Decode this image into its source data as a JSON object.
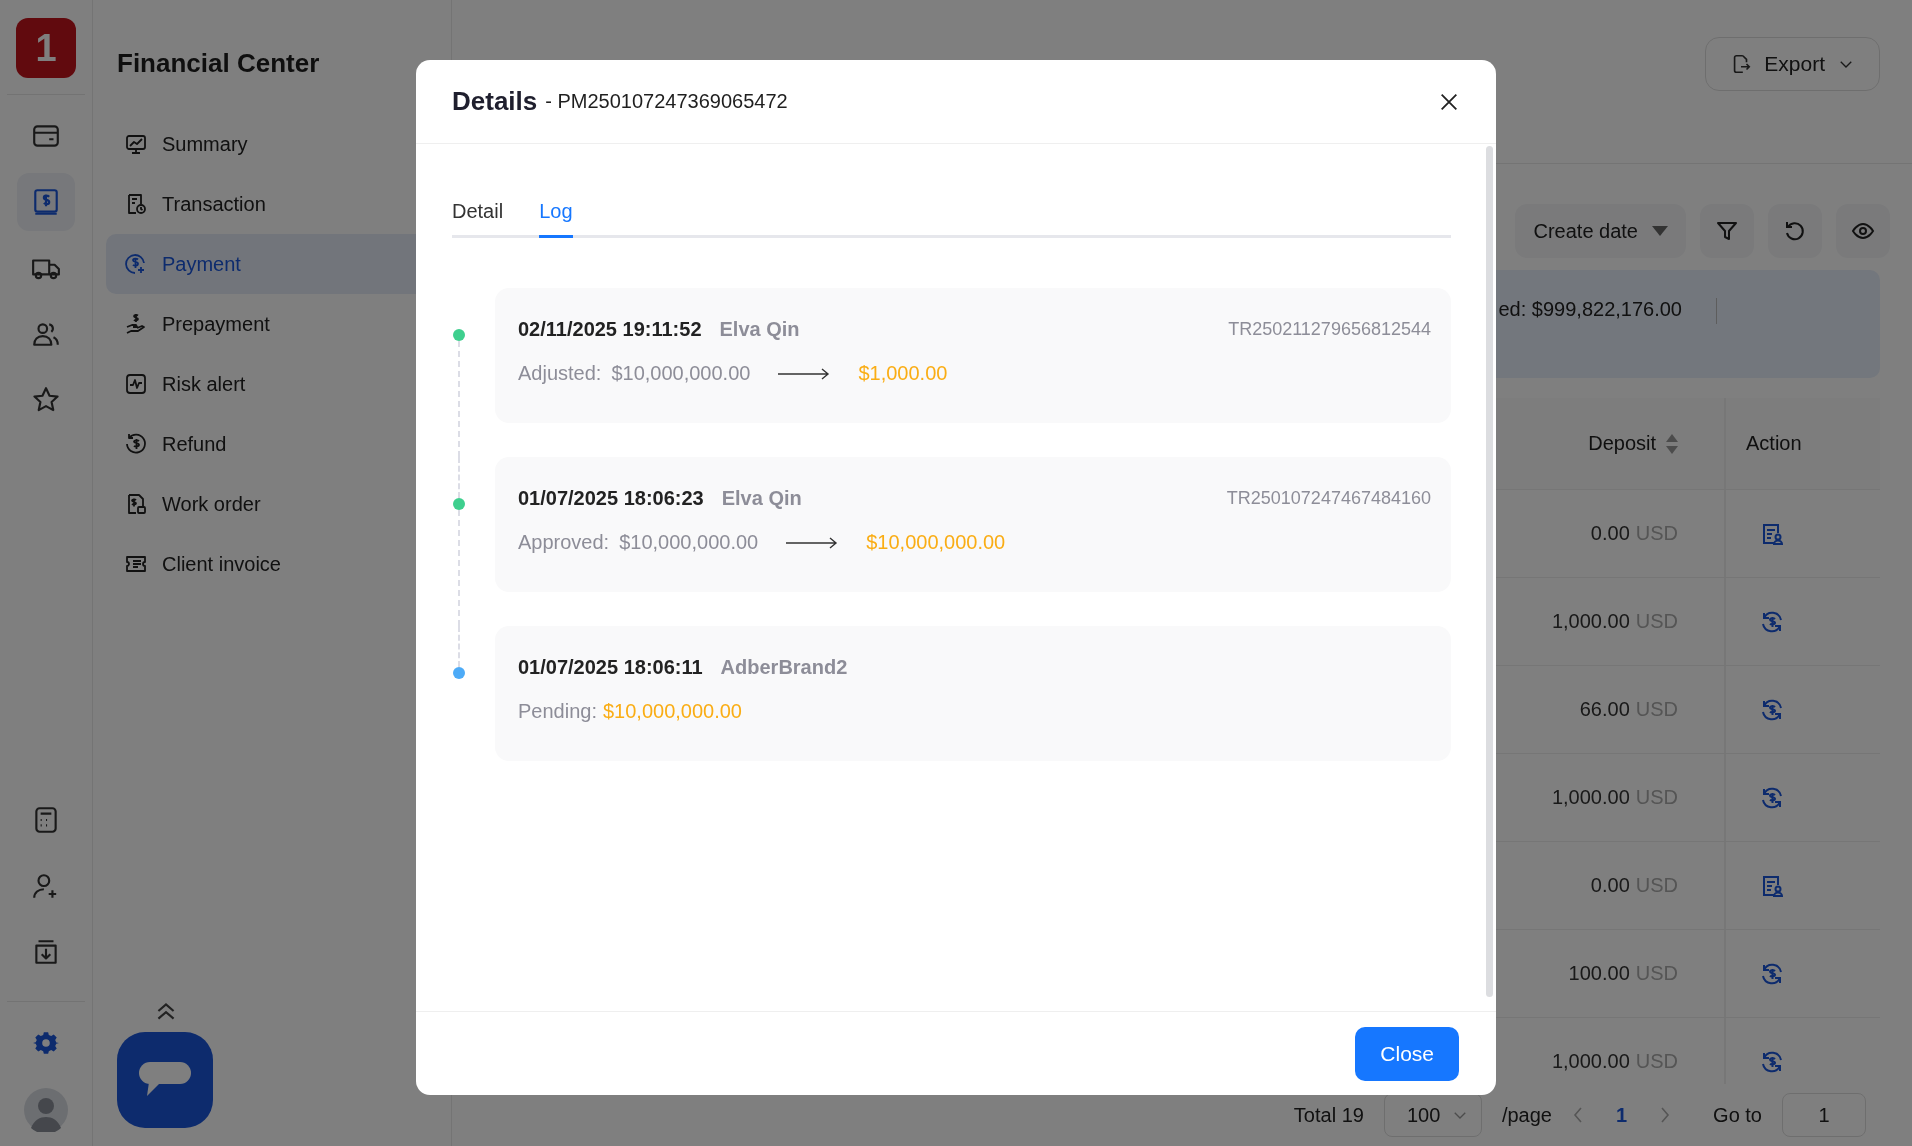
{
  "rail": {
    "logo": "1",
    "items": [
      {
        "kind": "card",
        "selected": false
      },
      {
        "kind": "dollar",
        "selected": true
      },
      {
        "kind": "truck",
        "selected": false
      },
      {
        "kind": "users",
        "selected": false
      },
      {
        "kind": "star",
        "selected": false
      }
    ],
    "bottom_items": [
      {
        "kind": "calculator"
      },
      {
        "kind": "user-add"
      },
      {
        "kind": "download"
      }
    ]
  },
  "sidebar": {
    "title": "Financial Center",
    "items": [
      {
        "label": "Summary",
        "kind": "chart",
        "selected": false
      },
      {
        "label": "Transaction",
        "kind": "receipt",
        "selected": false
      },
      {
        "label": "Payment",
        "kind": "coin",
        "selected": true
      },
      {
        "label": "Prepayment",
        "kind": "hand",
        "selected": false
      },
      {
        "label": "Risk alert",
        "kind": "pulse",
        "selected": false
      },
      {
        "label": "Refund",
        "kind": "refund",
        "selected": false
      },
      {
        "label": "Work order",
        "kind": "doc",
        "selected": false
      },
      {
        "label": "Client invoice",
        "kind": "ticket",
        "selected": false
      }
    ]
  },
  "main": {
    "export_button": "Export",
    "sort_select": "Create date",
    "summary": "ed: $999,822,176.00",
    "table": {
      "columns": [
        "Deposit",
        "Action"
      ],
      "rows": [
        {
          "deposit": "0.00",
          "currency": "USD",
          "kind": "document"
        },
        {
          "deposit": "1,000.00",
          "currency": "USD",
          "kind": "refund"
        },
        {
          "deposit": "66.00",
          "currency": "USD",
          "kind": "refund"
        },
        {
          "deposit": "1,000.00",
          "currency": "USD",
          "kind": "refund"
        },
        {
          "deposit": "0.00",
          "currency": "USD",
          "kind": "document"
        },
        {
          "deposit": "100.00",
          "currency": "USD",
          "kind": "refund"
        },
        {
          "deposit": "1,000.00",
          "currency": "USD",
          "kind": "refund"
        }
      ]
    },
    "pagination": {
      "total": "Total 19",
      "page_size": "100",
      "per_page": "/page",
      "pages": [
        {
          "label": "1",
          "selected": true
        }
      ],
      "goto_label": "Go to",
      "goto_value": "1"
    }
  },
  "modal": {
    "title": "Details",
    "subtitle": "- PM250107247369065472",
    "tabs": [
      {
        "label": "Detail",
        "selected": false
      },
      {
        "label": "Log",
        "selected": true
      }
    ],
    "log": [
      {
        "kind": "change",
        "time": "02/11/2025 19:11:52",
        "user": "Elva Qin",
        "reference": "TR250211279656812544",
        "label": "Adjusted:",
        "from": "$10,000,000.00",
        "to": "$1,000.00",
        "color": "#3ecf8e"
      },
      {
        "kind": "change",
        "time": "01/07/2025 18:06:23",
        "user": "Elva Qin",
        "reference": "TR250107247467484160",
        "label": "Approved:",
        "from": "$10,000,000.00",
        "to": "$10,000,000.00",
        "color": "#3ecf8e"
      },
      {
        "kind": "status",
        "time": "01/07/2025 18:06:11",
        "user": "AdberBrand2",
        "label": "Pending:",
        "to": "$10,000,000.00",
        "color": "#4dabf7"
      }
    ],
    "close_button": "Close"
  }
}
